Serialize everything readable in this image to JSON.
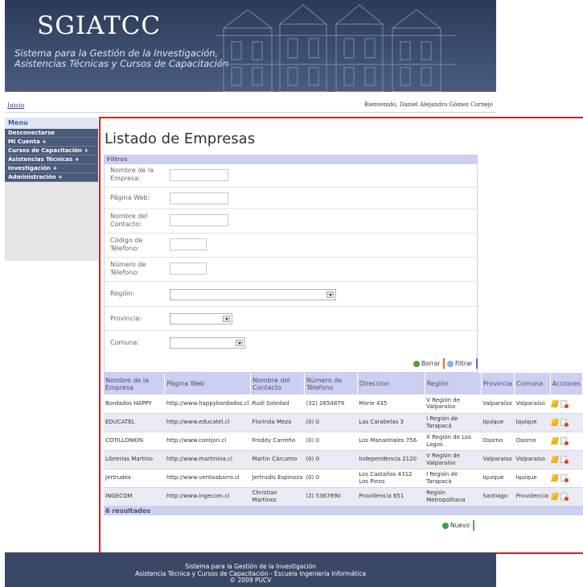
{
  "header": {
    "app_name": "SGIATCC",
    "subtitle_line1": "Sistema para la Gestión de la Investigación,",
    "subtitle_line2": "Asistencias Técnicas y Cursos de Capacitación"
  },
  "topbar": {
    "home_link": "Inicio",
    "welcome": "Bienvenido, Daniel Alejandro Gómez Cornejo"
  },
  "sidebar": {
    "title": "Menu",
    "items": [
      {
        "label": "Desconectarse"
      },
      {
        "label": "Mi Cuenta +"
      },
      {
        "label": "Cursos de Capacitación +"
      },
      {
        "label": "Asistencias Técnicas +"
      },
      {
        "label": "Investigación +"
      },
      {
        "label": "Administración +"
      }
    ]
  },
  "page_title": "Listado de Empresas",
  "filters": {
    "header": "Filtros",
    "company_name_label": "Nombre de la Empresa:",
    "company_name_value": "",
    "website_label": "Página Web:",
    "website_value": "",
    "contact_label": "Nombre del Contacto:",
    "contact_value": "",
    "phone_code_label": "Código de Télefono:",
    "phone_code_value": "",
    "phone_number_label": "Número de Télefono:",
    "phone_number_value": "",
    "region_label": "Región:",
    "region_value": "",
    "province_label": "Provincia:",
    "province_value": "",
    "commune_label": "Comuna:",
    "commune_value": "",
    "clear_button": "Borrar",
    "filter_button": "Filtrar"
  },
  "table": {
    "headers": [
      "Nombre de la Empresa",
      "Página Web",
      "Nombre del Contacto",
      "Número de Télefono",
      "Direccion",
      "Región",
      "Provincia",
      "Comuna",
      "Acciones"
    ],
    "rows": [
      [
        "Bordados HAPPY",
        "http://www.happybordados.cl",
        "Rudi Soledad",
        "(32) 2654879",
        "Morie 435",
        "V Región de Valparaíso",
        "Valparaíso",
        "Valparaíso"
      ],
      [
        "EDUCATEL",
        "http://www.educatel.cl",
        "Florinda Meza",
        "(0) 0",
        "Las Carabelas 3",
        "I Región de Tarapacá",
        "Iquique",
        "Iquique"
      ],
      [
        "COTILLONKIN",
        "http://www.contjon.cl",
        "Freddy Carreño",
        "(0) 0",
        "Los Manantiales 756",
        "X Región de Los Lagos",
        "Osorno",
        "Osorno"
      ],
      [
        "Librerias Martino",
        "http://www.martinina.cl",
        "Martín Cárcamo",
        "(0) 0",
        "Independencia 2120",
        "V Región de Valparaíso",
        "Valparaíso",
        "Valparaíso"
      ],
      [
        "Jertrudex",
        "http://www.ventaabarro.cl",
        "Jertrudis Espinoza",
        "(0) 0",
        "Los Castaños 4312 Los Pinos",
        "I Región de Tarapacá",
        "Iquique",
        "Iquique"
      ],
      [
        "INGECOM",
        "http://www.ingecom.cl",
        "Christian Martínez",
        "(2) 5367890",
        "Providencia 651",
        "Región Metropolitana",
        "Santiago",
        "Providencia"
      ]
    ],
    "results": "6 resultados"
  },
  "new_button": "Nuevo",
  "footer": {
    "line1": "Sistema para la Gestión de la Investigación",
    "line2": "Asistencia Técnica y Cursos de Capacitación - Escuela Ingeniería Informática",
    "line3": "© 2009 PUCV"
  }
}
